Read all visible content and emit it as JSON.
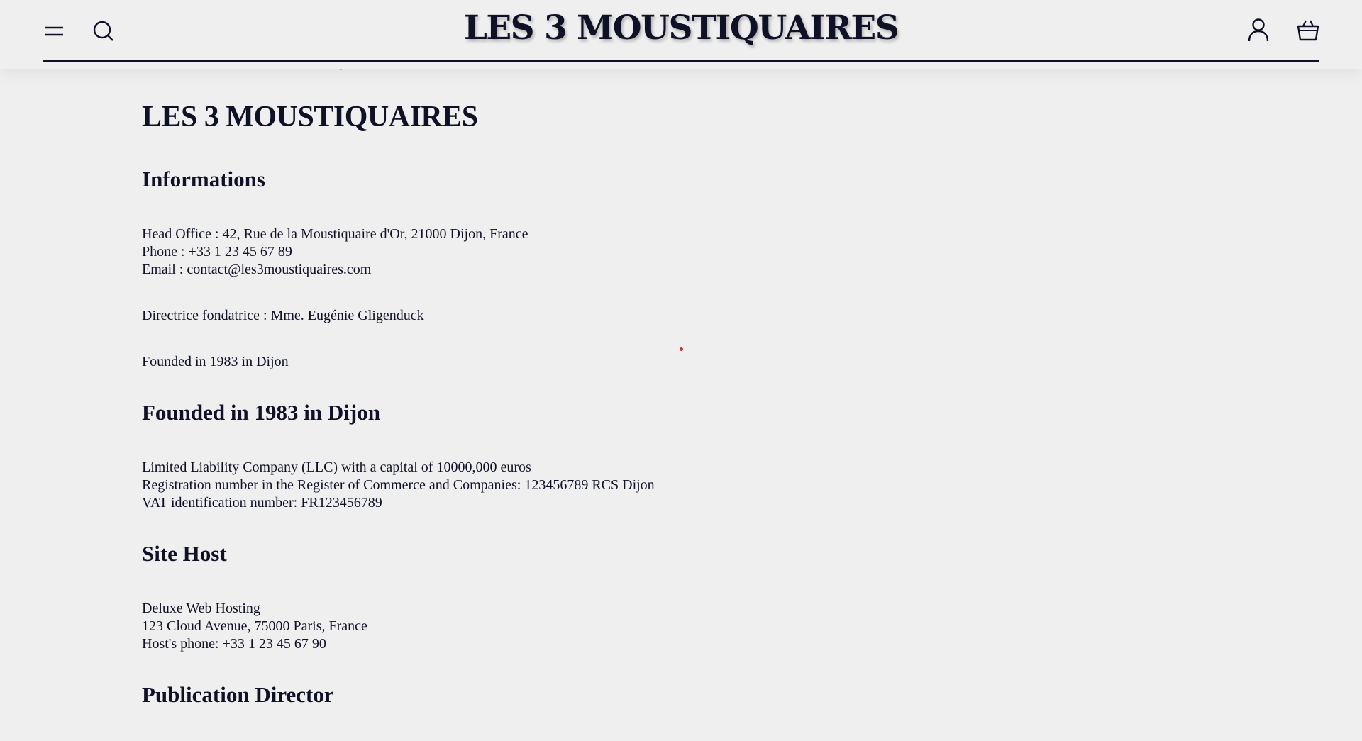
{
  "header": {
    "brand": "LES 3 MOUSTIQUAIRES",
    "icons": [
      "menu-icon",
      "search-icon",
      "account-icon",
      "basket-icon"
    ]
  },
  "content": {
    "title": "LES 3 MOUSTIQUAIRES",
    "sections": [
      {
        "heading": "Informations",
        "paragraphs": [
          [
            "Head Office : 42, Rue de la Moustiquaire d'Or, 21000 Dijon, France",
            "Phone : +33 1 23 45 67 89",
            "Email : contact@les3moustiquaires.com"
          ],
          [
            "Directrice fondatrice : Mme. Eugénie Gligenduck"
          ],
          [
            "Founded in 1983 in Dijon"
          ]
        ]
      },
      {
        "heading": "Founded in 1983 in Dijon",
        "paragraphs": [
          [
            "Limited Liability Company (LLC) with a capital of 10000,000 euros",
            "Registration number in the Register of Commerce and Companies: 123456789 RCS Dijon",
            "VAT identification number: FR123456789"
          ]
        ]
      },
      {
        "heading": "Site Host",
        "paragraphs": [
          [
            "Deluxe Web Hosting",
            "123 Cloud Avenue, 75000 Paris, France",
            "Host's phone: +33 1 23 45 67 90"
          ]
        ]
      },
      {
        "heading": "Publication Director",
        "paragraphs": []
      }
    ]
  },
  "colors": {
    "background": "#efefef",
    "text": "#0f1226",
    "marker": "#d0312d"
  }
}
